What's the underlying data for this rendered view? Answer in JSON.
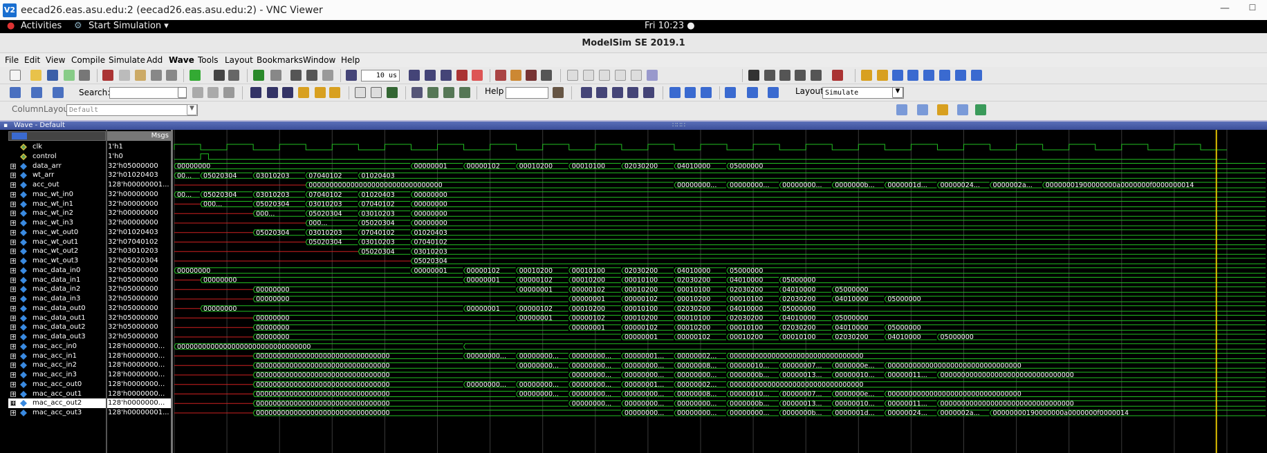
{
  "vnc": {
    "title": "eecad26.eas.asu.edu:2 (eecad26.eas.asu.edu:2) - VNC Viewer",
    "logo": "V2"
  },
  "gnome": {
    "activities": "Activities",
    "app_menu": "Start Simulation ▾",
    "clock": "Fri 10:23 ●"
  },
  "app": {
    "title": "ModelSim SE 2019.1"
  },
  "menu": [
    "File",
    "Edit",
    "View",
    "Compile",
    "Simulate",
    "Add",
    "Wave",
    "Tools",
    "Layout",
    "Bookmarks",
    "Window",
    "Help"
  ],
  "toolbar": {
    "run_length": "10 us",
    "search_label": "Search:",
    "search_value": "",
    "help_label": "Help",
    "layout_label": "Layout",
    "layout_value": "Simulate",
    "column_layout_label": "ColumnLayout",
    "column_layout_value": "Default"
  },
  "wave": {
    "window_title": "Wave - Default",
    "msgs_header": "Msgs"
  },
  "signals": [
    {
      "name": "clk",
      "value": "1'h1",
      "kind": "clk",
      "expand": false
    },
    {
      "name": "control",
      "value": "1'h0",
      "kind": "ctrl",
      "expand": false
    },
    {
      "name": "data_arr",
      "value": "32'h05000000",
      "kind": "bus",
      "expand": true
    },
    {
      "name": "wt_arr",
      "value": "32'h01020403",
      "kind": "bus",
      "expand": true
    },
    {
      "name": "acc_out",
      "value": "128'h00000001...",
      "kind": "bus",
      "expand": true
    },
    {
      "name": "mac_wt_in0",
      "value": "32'h00000000",
      "kind": "bus",
      "expand": true
    },
    {
      "name": "mac_wt_in1",
      "value": "32'h00000000",
      "kind": "bus",
      "expand": true
    },
    {
      "name": "mac_wt_in2",
      "value": "32'h00000000",
      "kind": "bus",
      "expand": true
    },
    {
      "name": "mac_wt_in3",
      "value": "32'h00000000",
      "kind": "bus",
      "expand": true
    },
    {
      "name": "mac_wt_out0",
      "value": "32'h01020403",
      "kind": "bus",
      "expand": true
    },
    {
      "name": "mac_wt_out1",
      "value": "32'h07040102",
      "kind": "bus",
      "expand": true
    },
    {
      "name": "mac_wt_out2",
      "value": "32'h03010203",
      "kind": "bus",
      "expand": true
    },
    {
      "name": "mac_wt_out3",
      "value": "32'h05020304",
      "kind": "bus",
      "expand": true
    },
    {
      "name": "mac_data_in0",
      "value": "32'h05000000",
      "kind": "bus",
      "expand": true
    },
    {
      "name": "mac_data_in1",
      "value": "32'h05000000",
      "kind": "bus",
      "expand": true
    },
    {
      "name": "mac_data_in2",
      "value": "32'h05000000",
      "kind": "bus",
      "expand": true
    },
    {
      "name": "mac_data_in3",
      "value": "32'h05000000",
      "kind": "bus",
      "expand": true
    },
    {
      "name": "mac_data_out0",
      "value": "32'h05000000",
      "kind": "bus",
      "expand": true
    },
    {
      "name": "mac_data_out1",
      "value": "32'h05000000",
      "kind": "bus",
      "expand": true
    },
    {
      "name": "mac_data_out2",
      "value": "32'h05000000",
      "kind": "bus",
      "expand": true
    },
    {
      "name": "mac_data_out3",
      "value": "32'h05000000",
      "kind": "bus",
      "expand": true
    },
    {
      "name": "mac_acc_in0",
      "value": "128'h0000000...",
      "kind": "bus",
      "expand": true
    },
    {
      "name": "mac_acc_in1",
      "value": "128'h0000000...",
      "kind": "bus",
      "expand": true
    },
    {
      "name": "mac_acc_in2",
      "value": "128'h0000000...",
      "kind": "bus",
      "expand": true
    },
    {
      "name": "mac_acc_in3",
      "value": "128'h0000000...",
      "kind": "bus",
      "expand": true
    },
    {
      "name": "mac_acc_out0",
      "value": "128'h0000000...",
      "kind": "bus",
      "expand": true
    },
    {
      "name": "mac_acc_out1",
      "value": "128'h0000000...",
      "kind": "bus",
      "expand": true
    },
    {
      "name": "mac_acc_out2",
      "value": "128'h0000000...",
      "kind": "bus",
      "expand": true,
      "selected": true
    },
    {
      "name": "mac_acc_out3",
      "value": "128'h00000001...",
      "kind": "bus",
      "expand": true
    }
  ],
  "waves": {
    "colors": {
      "line": "#22c022",
      "text": "#ffffff",
      "red": "#d02020",
      "cursor": "#e0c000",
      "grid": "#3a3a3a"
    },
    "time_span": 40,
    "clock_period": 2,
    "cursor_time": 39.6,
    "ctrl_rise": 1,
    "buses": [
      [
        [
          0,
          "00000000"
        ],
        [
          9,
          "00000001"
        ],
        [
          11,
          "00000102"
        ],
        [
          13,
          "00010200"
        ],
        [
          15,
          "00010100"
        ],
        [
          17,
          "02030200"
        ],
        [
          19,
          "04010000"
        ],
        [
          21,
          "05000000"
        ]
      ],
      [
        [
          0,
          "000..."
        ],
        [
          1,
          "05020304"
        ],
        [
          3,
          "03010203"
        ],
        [
          5,
          "07040102"
        ],
        [
          7,
          "01020403"
        ]
      ],
      [
        [
          0,
          "X"
        ],
        [
          5,
          "00000000000000000000000000000000"
        ],
        [
          19,
          "000000000..."
        ],
        [
          21,
          "000000000..."
        ],
        [
          23,
          "000000000..."
        ],
        [
          25,
          "0000000b0..."
        ],
        [
          27,
          "0000001d0..."
        ],
        [
          29,
          "000000240..."
        ],
        [
          31,
          "0000002a0..."
        ],
        [
          33,
          "00000001900000000a0000000f0000000014"
        ]
      ],
      [
        [
          0,
          "000..."
        ],
        [
          1,
          "05020304"
        ],
        [
          3,
          "03010203"
        ],
        [
          5,
          "07040102"
        ],
        [
          7,
          "01020403"
        ],
        [
          9,
          "00000000"
        ]
      ],
      [
        [
          0,
          "X"
        ],
        [
          1,
          "000..."
        ],
        [
          3,
          "05020304"
        ],
        [
          5,
          "03010203"
        ],
        [
          7,
          "07040102"
        ],
        [
          9,
          "00000000"
        ]
      ],
      [
        [
          0,
          "X"
        ],
        [
          3,
          "000..."
        ],
        [
          5,
          "05020304"
        ],
        [
          7,
          "03010203"
        ],
        [
          9,
          "00000000"
        ]
      ],
      [
        [
          0,
          "X"
        ],
        [
          5,
          "000..."
        ],
        [
          7,
          "05020304"
        ],
        [
          9,
          "00000000"
        ]
      ],
      [
        [
          0,
          "X"
        ],
        [
          3,
          "05020304"
        ],
        [
          5,
          "03010203"
        ],
        [
          7,
          "07040102"
        ],
        [
          9,
          "01020403"
        ]
      ],
      [
        [
          0,
          "X"
        ],
        [
          5,
          "05020304"
        ],
        [
          7,
          "03010203"
        ],
        [
          9,
          "07040102"
        ]
      ],
      [
        [
          0,
          "X"
        ],
        [
          7,
          "05020304"
        ],
        [
          9,
          "03010203"
        ]
      ],
      [
        [
          0,
          "X"
        ],
        [
          9,
          "05020304"
        ]
      ],
      [
        [
          0,
          "00000000"
        ],
        [
          9,
          "00000001"
        ],
        [
          11,
          "00000102"
        ],
        [
          13,
          "00010200"
        ],
        [
          15,
          "00010100"
        ],
        [
          17,
          "02030200"
        ],
        [
          19,
          "04010000"
        ],
        [
          21,
          "05000000"
        ]
      ],
      [
        [
          0,
          "X"
        ],
        [
          1,
          "00000000"
        ],
        [
          11,
          "00000001"
        ],
        [
          13,
          "00000102"
        ],
        [
          15,
          "00010200"
        ],
        [
          17,
          "00010100"
        ],
        [
          19,
          "02030200"
        ],
        [
          21,
          "04010000"
        ],
        [
          23,
          "05000000"
        ]
      ],
      [
        [
          0,
          "X"
        ],
        [
          3,
          "00000000"
        ],
        [
          13,
          "00000001"
        ],
        [
          15,
          "00000102"
        ],
        [
          17,
          "00010200"
        ],
        [
          19,
          "00010100"
        ],
        [
          21,
          "02030200"
        ],
        [
          23,
          "04010000"
        ],
        [
          25,
          "05000000"
        ]
      ],
      [
        [
          0,
          "X"
        ],
        [
          3,
          "00000000"
        ],
        [
          15,
          "00000001"
        ],
        [
          17,
          "00000102"
        ],
        [
          19,
          "00010200"
        ],
        [
          21,
          "00010100"
        ],
        [
          23,
          "02030200"
        ],
        [
          25,
          "04010000"
        ],
        [
          27,
          "05000000"
        ]
      ],
      [
        [
          0,
          "X"
        ],
        [
          1,
          "00000000"
        ],
        [
          11,
          "00000001"
        ],
        [
          13,
          "00000102"
        ],
        [
          15,
          "00010200"
        ],
        [
          17,
          "00010100"
        ],
        [
          19,
          "02030200"
        ],
        [
          21,
          "04010000"
        ],
        [
          23,
          "05000000"
        ]
      ],
      [
        [
          0,
          "X"
        ],
        [
          3,
          "00000000"
        ],
        [
          13,
          "00000001"
        ],
        [
          15,
          "00000102"
        ],
        [
          17,
          "00010200"
        ],
        [
          19,
          "00010100"
        ],
        [
          21,
          "02030200"
        ],
        [
          23,
          "04010000"
        ],
        [
          25,
          "05000000"
        ]
      ],
      [
        [
          0,
          "X"
        ],
        [
          3,
          "00000000"
        ],
        [
          15,
          "00000001"
        ],
        [
          17,
          "00000102"
        ],
        [
          19,
          "00010200"
        ],
        [
          21,
          "00010100"
        ],
        [
          23,
          "02030200"
        ],
        [
          25,
          "04010000"
        ],
        [
          27,
          "05000000"
        ]
      ],
      [
        [
          0,
          "X"
        ],
        [
          3,
          "00000000"
        ],
        [
          17,
          "00000001"
        ],
        [
          19,
          "00000102"
        ],
        [
          21,
          "00010200"
        ],
        [
          23,
          "00010100"
        ],
        [
          25,
          "02030200"
        ],
        [
          27,
          "04010000"
        ],
        [
          29,
          "05000000"
        ]
      ],
      [
        [
          0,
          "00000000000000000000000000000000"
        ],
        [
          11,
          ""
        ]
      ],
      [
        [
          0,
          "X"
        ],
        [
          3,
          "00000000000000000000000000000000"
        ],
        [
          11,
          "000000000..."
        ],
        [
          13,
          "000000000..."
        ],
        [
          15,
          "000000000..."
        ],
        [
          17,
          "000000010..."
        ],
        [
          19,
          "000000020..."
        ],
        [
          21,
          "00000000000000000000000000000000"
        ]
      ],
      [
        [
          0,
          "X"
        ],
        [
          3,
          "00000000000000000000000000000000"
        ],
        [
          13,
          "000000000..."
        ],
        [
          15,
          "000000000..."
        ],
        [
          17,
          "000000000..."
        ],
        [
          19,
          "000000080..."
        ],
        [
          21,
          "000000100..."
        ],
        [
          23,
          "000000070..."
        ],
        [
          25,
          "0000000e0..."
        ],
        [
          27,
          "00000000000000000000000000000000"
        ]
      ],
      [
        [
          0,
          "X"
        ],
        [
          3,
          "00000000000000000000000000000000"
        ],
        [
          15,
          "000000000..."
        ],
        [
          17,
          "000000000..."
        ],
        [
          19,
          "000000000..."
        ],
        [
          21,
          "0000000b0..."
        ],
        [
          23,
          "000000130..."
        ],
        [
          25,
          "000000100..."
        ],
        [
          27,
          "000000110..."
        ],
        [
          29,
          "00000000000000000000000000000000"
        ]
      ],
      [
        [
          0,
          "X"
        ],
        [
          3,
          "00000000000000000000000000000000"
        ],
        [
          11,
          "000000000..."
        ],
        [
          13,
          "000000000..."
        ],
        [
          15,
          "000000000..."
        ],
        [
          17,
          "000000010..."
        ],
        [
          19,
          "000000020..."
        ],
        [
          21,
          "00000000000000000000000000000000"
        ]
      ],
      [
        [
          0,
          "X"
        ],
        [
          3,
          "00000000000000000000000000000000"
        ],
        [
          13,
          "000000000..."
        ],
        [
          15,
          "000000000..."
        ],
        [
          17,
          "000000000..."
        ],
        [
          19,
          "000000080..."
        ],
        [
          21,
          "000000100..."
        ],
        [
          23,
          "000000070..."
        ],
        [
          25,
          "0000000e0..."
        ],
        [
          27,
          "00000000000000000000000000000000"
        ]
      ],
      [
        [
          0,
          "X"
        ],
        [
          3,
          "00000000000000000000000000000000"
        ],
        [
          15,
          "000000000..."
        ],
        [
          17,
          "000000000..."
        ],
        [
          19,
          "000000000..."
        ],
        [
          21,
          "0000000b0..."
        ],
        [
          23,
          "000000130..."
        ],
        [
          25,
          "000000100..."
        ],
        [
          27,
          "000000110..."
        ],
        [
          29,
          "00000000000000000000000000000000"
        ]
      ],
      [
        [
          0,
          "X"
        ],
        [
          3,
          "00000000000000000000000000000000"
        ],
        [
          17,
          "000000000..."
        ],
        [
          19,
          "000000000..."
        ],
        [
          21,
          "000000000..."
        ],
        [
          23,
          "0000000b0..."
        ],
        [
          25,
          "0000001d0..."
        ],
        [
          27,
          "000000240..."
        ],
        [
          29,
          "0000002a0..."
        ],
        [
          31,
          "00000000190000000a0000000f0000014"
        ]
      ]
    ]
  }
}
